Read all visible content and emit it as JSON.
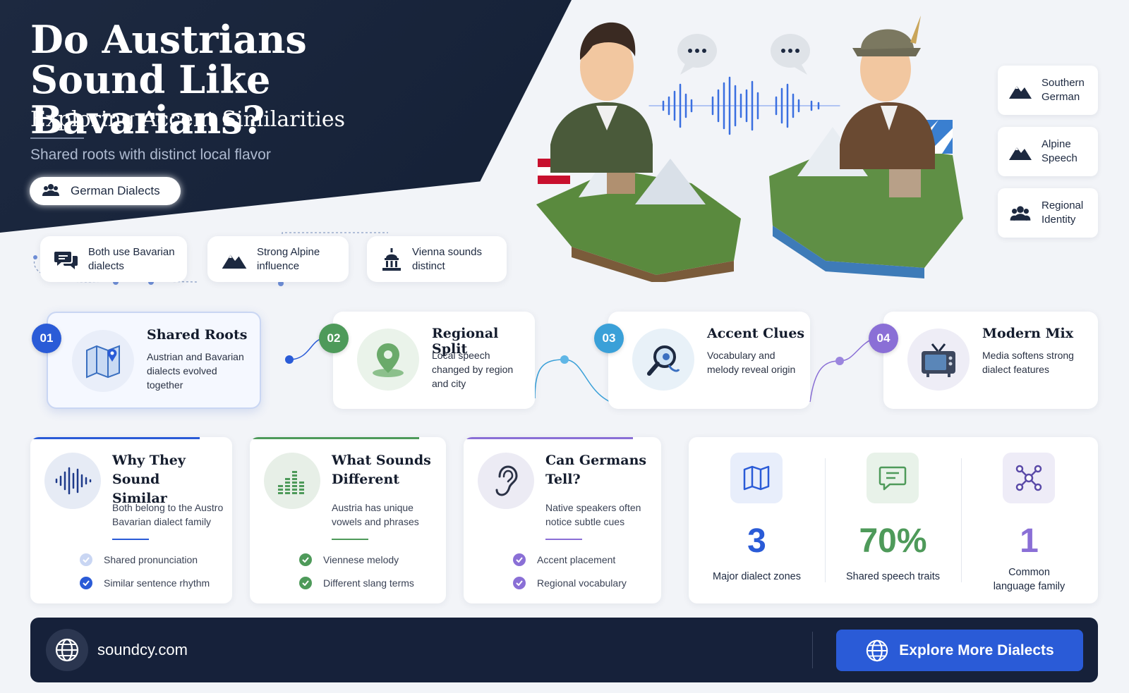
{
  "hero": {
    "title": "Do Austrians Sound Like Bavarians?",
    "subtitle": "Exploring Accent Similarities",
    "tagline": "Shared roots with distinct local flavor",
    "pill": {
      "label": "German Dialects",
      "icon": "people-icon"
    }
  },
  "side_tags": [
    {
      "label": "Southern German",
      "icon": "mountain-icon"
    },
    {
      "label": "Alpine Speech",
      "icon": "mountain-icon"
    },
    {
      "label": "Regional Identity",
      "icon": "people-icon"
    }
  ],
  "chips": [
    {
      "label": "Both use Bavarian dialects",
      "icon": "chat-bubbles-icon"
    },
    {
      "label": "Strong Alpine influence",
      "icon": "mountain-icon"
    },
    {
      "label": "Vienna sounds distinct",
      "icon": "landmark-icon"
    }
  ],
  "steps": [
    {
      "num": "01",
      "title": "Shared Roots",
      "desc": "Austrian and Bavarian dialects evolved together",
      "icon": "map-icon",
      "color": "#2a5bd7"
    },
    {
      "num": "02",
      "title": "Regional Split",
      "desc": "Local speech changed by region and city",
      "icon": "location-pin-icon",
      "color": "#4e9a5a"
    },
    {
      "num": "03",
      "title": "Accent Clues",
      "desc": "Vocabulary and melody reveal origin",
      "icon": "magnifier-icon",
      "color": "#3aa0d8"
    },
    {
      "num": "04",
      "title": "Modern Mix",
      "desc": "Media softens strong dialect features",
      "icon": "tv-icon",
      "color": "#8a6fd6"
    }
  ],
  "info_cards": [
    {
      "title": "Why They Sound Similar",
      "desc": "Both belong to the Austro Bavarian dialect family",
      "icon": "waveform-icon",
      "color": "#2a5bd7",
      "checks": [
        "Shared pronunciation",
        "Similar sentence rhythm"
      ]
    },
    {
      "title": "What Sounds Different",
      "desc": "Austria has unique vowels and phrases",
      "icon": "equalizer-icon",
      "color": "#4e9a5a",
      "checks": [
        "Viennese melody",
        "Different slang terms"
      ]
    },
    {
      "title": "Can Germans Tell?",
      "desc": "Native speakers often notice subtle cues",
      "icon": "ear-icon",
      "color": "#8a6fd6",
      "checks": [
        "Accent placement",
        "Regional vocabulary"
      ]
    }
  ],
  "stats": [
    {
      "value": "3",
      "label": "Major dialect zones",
      "icon": "map-icon",
      "color": "#2a5bd7"
    },
    {
      "value": "70%",
      "label": "Shared speech traits",
      "icon": "speech-bubble-icon",
      "color": "#4e9a5a"
    },
    {
      "value": "1",
      "label": "Common language family",
      "icon": "network-icon",
      "color": "#8a6fd6"
    }
  ],
  "footer": {
    "site": "soundcy.com",
    "cta": "Explore More Dialects",
    "icon": "globe-icon"
  }
}
